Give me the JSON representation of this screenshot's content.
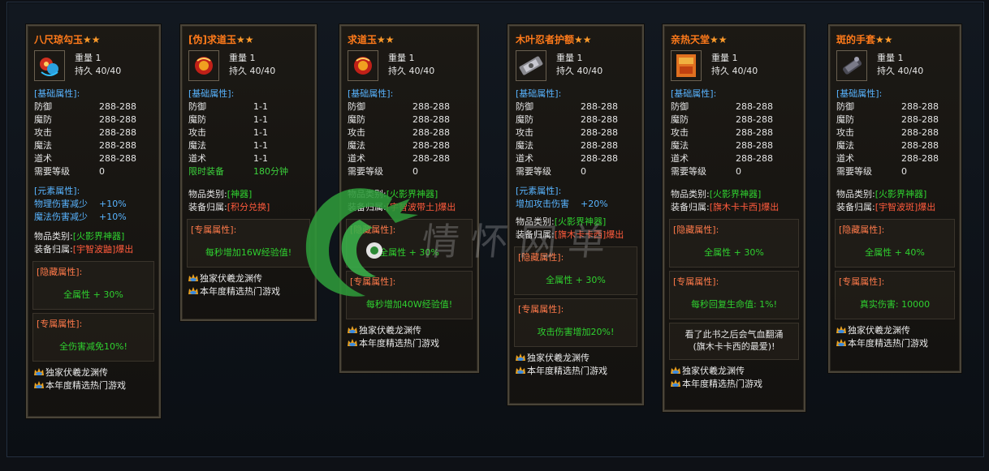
{
  "colors": {
    "title": "#ff7a1a",
    "section": "#58b4ff",
    "green": "#2fd02f",
    "red": "#ff5a3c"
  },
  "watermark_text": "情怀网单",
  "ad_lines": [
    "独家伏羲龙渊传",
    "本年度精选热门游戏"
  ],
  "tooltips": [
    {
      "title": "八尺琼勾玉",
      "stars": "★★",
      "icon": "magatama-icon",
      "weight": "重量 1",
      "durability": "持久 40/40",
      "base_label": "[基础属性]:",
      "stats": [
        [
          "防御",
          "288-288"
        ],
        [
          "魔防",
          "288-288"
        ],
        [
          "攻击",
          "288-288"
        ],
        [
          "魔法",
          "288-288"
        ],
        [
          "道术",
          "288-288"
        ],
        [
          "需要等级",
          "0"
        ]
      ],
      "element_label": "[元素属性]:",
      "element_rows": [
        [
          "物理伤害减少",
          "+10%"
        ],
        [
          "魔法伤害减少",
          "+10%"
        ]
      ],
      "category_key": "物品类别:",
      "category_val": "[火影界神器]",
      "owner_key": "装备归属:",
      "owner_val": "[宇智波鼬]爆出",
      "hidden_label": "[隐藏属性]:",
      "hidden_val": "全属性 + 30%",
      "exclusive_label": "[专属属性]:",
      "exclusive_val": "全伤害减免10%!"
    },
    {
      "title": "[伪]求道玉",
      "stars": "★★",
      "icon": "red-orb-icon",
      "weight": "重量 1",
      "durability": "持久 40/40",
      "base_label": "[基础属性]:",
      "stats": [
        [
          "防御",
          "1-1"
        ],
        [
          "魔防",
          "1-1"
        ],
        [
          "攻击",
          "1-1"
        ],
        [
          "魔法",
          "1-1"
        ],
        [
          "道术",
          "1-1"
        ]
      ],
      "limited_key": "限时装备",
      "limited_val": "180分钟",
      "category_key": "物品类别:",
      "category_val": "[神器]",
      "owner_key": "装备归属:",
      "owner_val": "[积分兑换]",
      "exclusive_label": "[专属属性]:",
      "exclusive_val": "每秒增加16W经验值!"
    },
    {
      "title": "求道玉",
      "stars": "★★",
      "icon": "red-orb-icon",
      "weight": "重量 1",
      "durability": "持久 40/40",
      "base_label": "[基础属性]:",
      "stats": [
        [
          "防御",
          "288-288"
        ],
        [
          "魔防",
          "288-288"
        ],
        [
          "攻击",
          "288-288"
        ],
        [
          "魔法",
          "288-288"
        ],
        [
          "道术",
          "288-288"
        ],
        [
          "需要等级",
          "0"
        ]
      ],
      "category_key": "物品类别:",
      "category_val": "[火影界神器]",
      "owner_key": "装备归属:",
      "owner_val": "[宇智波带土]爆出",
      "hidden_label": "[隐藏属性]:",
      "hidden_val": "全属性 + 30%",
      "exclusive_label": "[专属属性]:",
      "exclusive_val": "每秒增加40W经验值!"
    },
    {
      "title": "木叶忍者护额",
      "stars": "★★",
      "icon": "headband-icon",
      "weight": "重量 1",
      "durability": "持久 40/40",
      "base_label": "[基础属性]:",
      "stats": [
        [
          "防御",
          "288-288"
        ],
        [
          "魔防",
          "288-288"
        ],
        [
          "攻击",
          "288-288"
        ],
        [
          "魔法",
          "288-288"
        ],
        [
          "道术",
          "288-288"
        ],
        [
          "需要等级",
          "0"
        ]
      ],
      "element_label": "[元素属性]:",
      "element_rows": [
        [
          "增加攻击伤害",
          "+20%"
        ]
      ],
      "category_key": "物品类别:",
      "category_val": "[火影界神器]",
      "owner_key": "装备归属:",
      "owner_val": "[旗木卡卡西]爆出",
      "hidden_label": "[隐藏属性]:",
      "hidden_val": "全属性 + 30%",
      "exclusive_label": "[专属属性]:",
      "exclusive_val": "攻击伤害增加20%!"
    },
    {
      "title": "亲热天堂",
      "stars": "★★",
      "icon": "book-icon",
      "weight": "重量 1",
      "durability": "持久 40/40",
      "base_label": "[基础属性]:",
      "stats": [
        [
          "防御",
          "288-288"
        ],
        [
          "魔防",
          "288-288"
        ],
        [
          "攻击",
          "288-288"
        ],
        [
          "魔法",
          "288-288"
        ],
        [
          "道术",
          "288-288"
        ],
        [
          "需要等级",
          "0"
        ]
      ],
      "category_key": "物品类别:",
      "category_val": "[火影界神器]",
      "owner_key": "装备归属:",
      "owner_val": "[旗木卡卡西]爆出",
      "hidden_label": "[隐藏属性]:",
      "hidden_val": "全属性 + 30%",
      "exclusive_label": "[专属属性]:",
      "exclusive_val": "每秒回复生命值: 1%!",
      "flavor_1": "看了此书之后会气血翻涌",
      "flavor_2": "(旗木卡卡西的最爱)!"
    },
    {
      "title": "斑的手套",
      "stars": "★★",
      "icon": "glove-icon",
      "weight": "重量 1",
      "durability": "持久 40/40",
      "base_label": "[基础属性]:",
      "stats": [
        [
          "防御",
          "288-288"
        ],
        [
          "魔防",
          "288-288"
        ],
        [
          "攻击",
          "288-288"
        ],
        [
          "魔法",
          "288-288"
        ],
        [
          "道术",
          "288-288"
        ],
        [
          "需要等级",
          "0"
        ]
      ],
      "category_key": "物品类别:",
      "category_val": "[火影界神器]",
      "owner_key": "装备归属:",
      "owner_val": "[宇智波斑]爆出",
      "hidden_label": "[隐藏属性]:",
      "hidden_val": "全属性 + 40%",
      "exclusive_label": "[专属属性]:",
      "exclusive_val": "真实伤害: 10000"
    }
  ]
}
